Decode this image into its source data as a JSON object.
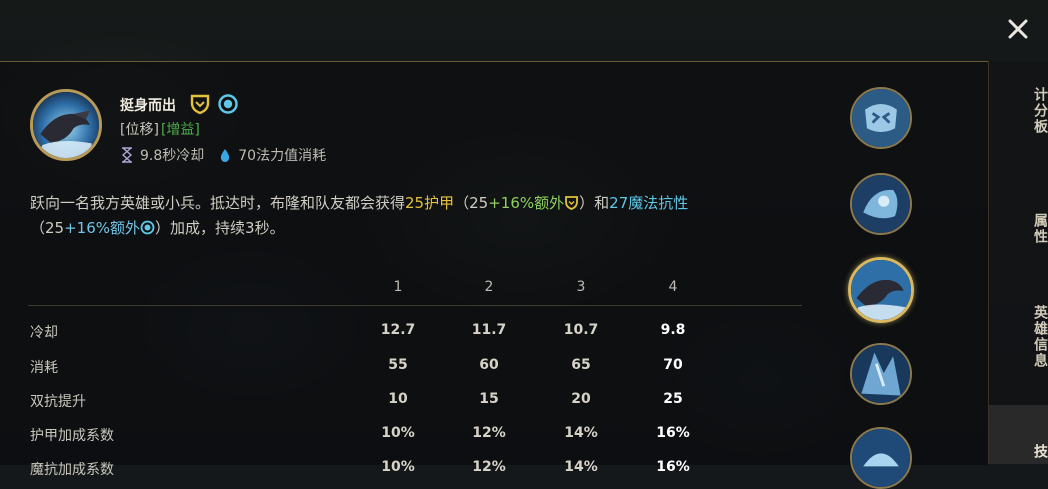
{
  "close_icon": "close-icon",
  "tabs": [
    {
      "label": "计分板",
      "active": false
    },
    {
      "label": "属性",
      "active": false
    },
    {
      "label": "英雄信息",
      "active": false
    },
    {
      "label": "技",
      "active": true
    }
  ],
  "skill": {
    "name": "挺身而出",
    "tag_type": "[位移]",
    "tag_effect": "[增益]",
    "cooldown": "9.8秒冷却",
    "cost": "70法力值消耗",
    "desc": {
      "p1": "跃向一名我方英雄或小兵。抵达时，布隆和队友都会获得",
      "armor": "25护甲",
      "p2": "（",
      "armor_base": "25",
      "armor_bonus": "+16%额外",
      "p3": "）和",
      "mr": "27魔法抗性",
      "p4": "（",
      "mr_base": "25",
      "mr_bonus": "+16%额外",
      "p5": "）加成，持续3秒。"
    }
  },
  "table": {
    "headers": [
      "1",
      "2",
      "3",
      "4"
    ],
    "rows": [
      {
        "label": "冷却",
        "values": [
          "12.7",
          "11.7",
          "10.7",
          "9.8"
        ]
      },
      {
        "label": "消耗",
        "values": [
          "55",
          "60",
          "65",
          "70"
        ]
      },
      {
        "label": "双抗提升",
        "values": [
          "10",
          "15",
          "20",
          "25"
        ]
      },
      {
        "label": "护甲加成系数",
        "values": [
          "10%",
          "12%",
          "14%",
          "16%"
        ]
      },
      {
        "label": "魔抗加成系数",
        "values": [
          "10%",
          "12%",
          "14%",
          "16%"
        ]
      }
    ]
  },
  "colors": {
    "gold_border": "#b99a56",
    "armor_yellow": "#e4c13a",
    "bonus_green": "#8fd15e",
    "mr_blue": "#5ec8e6",
    "tag_green": "#4caf4a"
  }
}
